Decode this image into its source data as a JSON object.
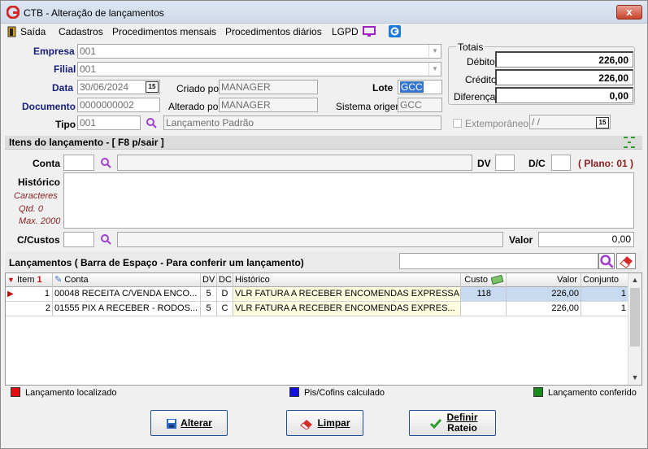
{
  "window": {
    "title": "CTB - Alteração de lançamentos",
    "close_label": "x"
  },
  "menu": {
    "items": [
      "Saída",
      "Cadastros",
      "Procedimentos mensais",
      "Procedimentos diários",
      "LGPD"
    ]
  },
  "header": {
    "empresa_label": "Empresa",
    "empresa_value": "001",
    "filial_label": "Filial",
    "filial_value": "001",
    "data_label": "Data",
    "data_value": "30/06/2024",
    "criado_label": "Criado por",
    "criado_value": "MANAGER",
    "lote_label": "Lote",
    "lote_value": "GCC",
    "documento_label": "Documento",
    "documento_value": "0000000002",
    "alterado_label": "Alterado por",
    "alterado_value": "MANAGER",
    "sistema_label": "Sistema origem",
    "sistema_value": "GCC",
    "tipo_label": "Tipo",
    "tipo_value": "001",
    "tipo_desc": "Lançamento Padrão",
    "extemporaneo_label": "Extemporâneo",
    "extemporaneo_value": "/ /",
    "calendar_label": "15"
  },
  "totais": {
    "title": "Totais",
    "debito_label": "Débito",
    "debito_value": "226,00",
    "credito_label": "Crédito",
    "credito_value": "226,00",
    "diferenca_label": "Diferença",
    "diferenca_value": "0,00"
  },
  "itens": {
    "section_title": "Itens do lançamento - [ F8 p/sair ]",
    "conta_label": "Conta",
    "dv_label": "DV",
    "dc_label": "D/C",
    "plano_label": "( Plano: 01 )",
    "historico_label": "Histórico",
    "caracteres_label": "Caracteres",
    "qtd_label": "Qtd. 0",
    "max_label": "Max. 2000",
    "ccustos_label": "C/Custos",
    "valor_label": "Valor",
    "valor_value": "0,00"
  },
  "lancamentos": {
    "title": "Lançamentos ( Barra de Espaço - Para conferir um lançamento)",
    "columns": {
      "item": "Item",
      "conta": "Conta",
      "dv": "DV",
      "dc": "DC",
      "historico": "Histórico",
      "custo": "Custo",
      "valor": "Valor",
      "conjunto": "Conjunto"
    },
    "rows": [
      {
        "item": "1",
        "conta": "00048 RECEITA C/VENDA ENCO...",
        "dv": "5",
        "dc": "D",
        "historico": "VLR FATURA A RECEBER  ENCOMENDAS EXPRESSA",
        "custo": "118",
        "valor": "226,00",
        "conjunto": "1"
      },
      {
        "item": "2",
        "conta": "01555 PIX A RECEBER - RODOS...",
        "dv": "5",
        "dc": "C",
        "historico": "VLR FATURA A RECEBER  ENCOMENDAS EXPRES...",
        "custo": "",
        "valor": "226,00",
        "conjunto": "1"
      }
    ]
  },
  "legend": {
    "localizado": "Lançamento localizado",
    "piscofins": "Pis/Cofins calculado",
    "conferido": "Lançamento conferido"
  },
  "buttons": {
    "alterar": "Alterar",
    "limpar": "Limpar",
    "definir": "Definir",
    "rateio": "Rateio"
  },
  "colors": {
    "localizado": "#e01010",
    "piscofins": "#1010e0",
    "conferido": "#1a8a1a",
    "accent": "#1e4f9c"
  }
}
